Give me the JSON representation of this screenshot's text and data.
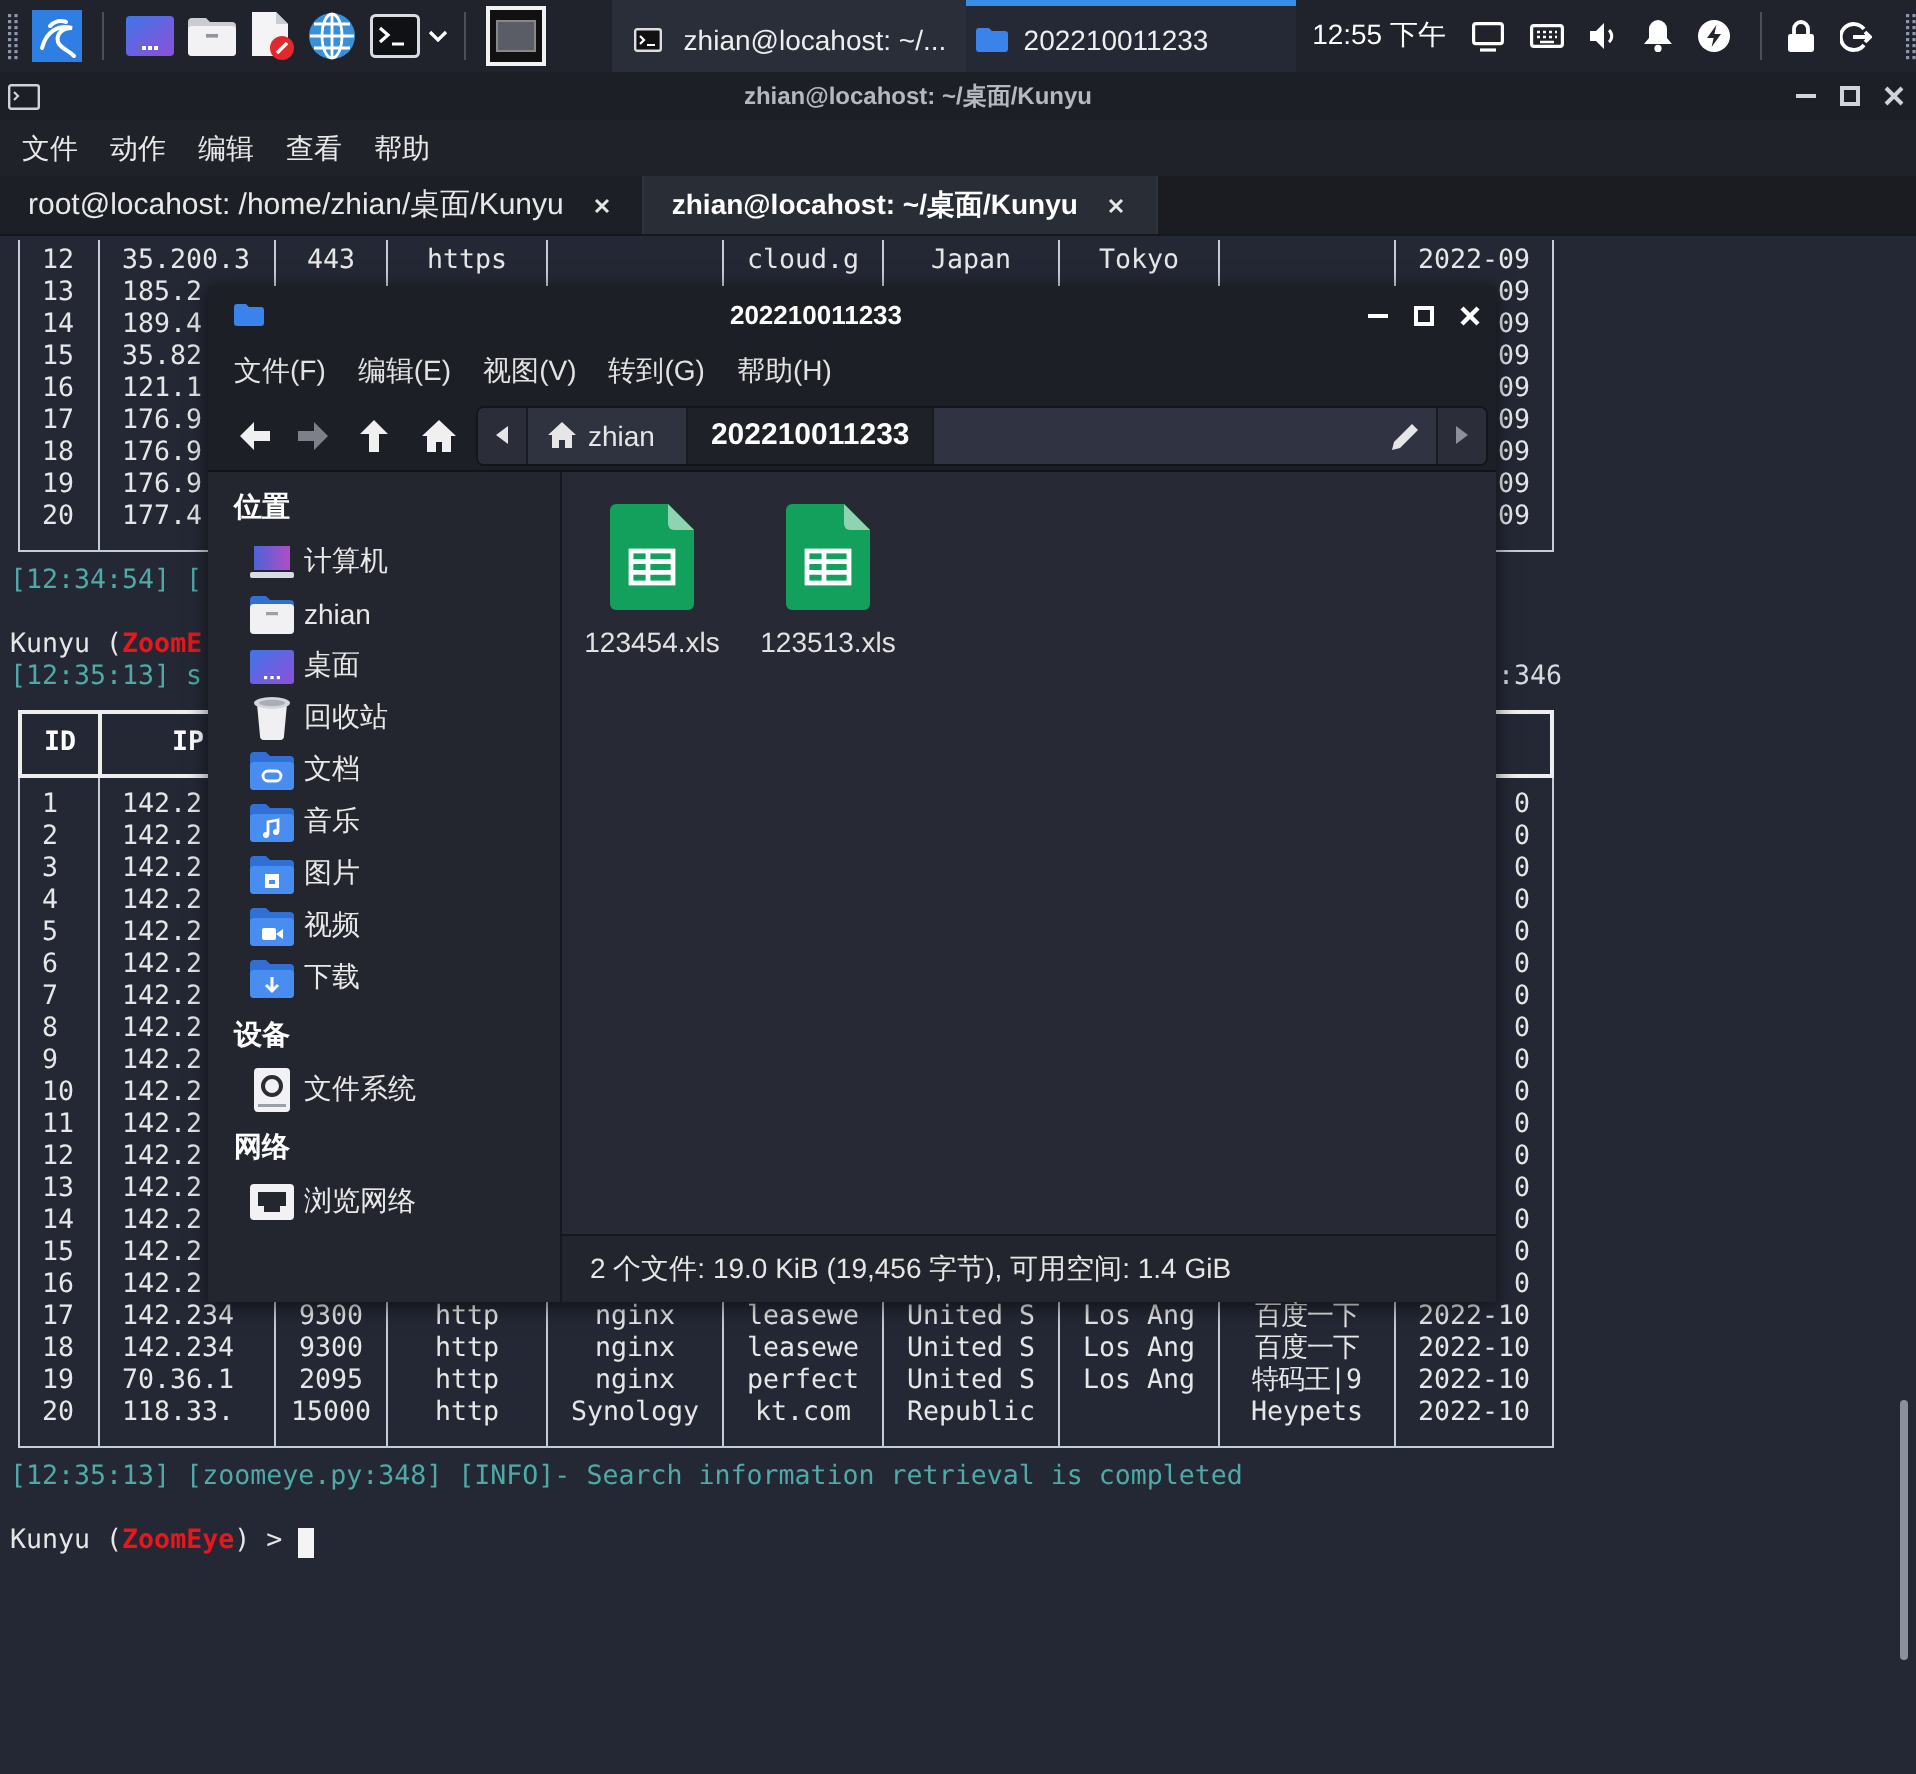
{
  "taskbar": {
    "tasks": [
      {
        "title": "zhian@locahost: ~/...",
        "kind": "terminal",
        "selected": false
      },
      {
        "title": "202210011233",
        "kind": "folder",
        "selected": true
      }
    ],
    "clock": "12:55 下午"
  },
  "terminal": {
    "title": "zhian@locahost: ~/桌面/Kunyu",
    "menu": [
      "文件",
      "动作",
      "编辑",
      "查看",
      "帮助"
    ],
    "tabs": [
      {
        "label": "root@locahost: /home/zhian/桌面/Kunyu",
        "selected": false
      },
      {
        "label": "zhian@locahost: ~/桌面/Kunyu",
        "selected": true
      }
    ],
    "output": [
      {
        "kind": "table",
        "rows": [
          {
            "column_1": "12",
            "column_2": "35.200.3",
            "column_3": "443",
            "column_4": "https",
            "column_6": "cloud.g",
            "column_7": "Japan",
            "column_8": "Tokyo",
            "column_10": "2022-09"
          },
          {
            "column_1": "13",
            "column_2": "185.2",
            "column_10": "09"
          },
          {
            "column_1": "14",
            "column_2": "189.4",
            "column_10": "09"
          },
          {
            "column_1": "15",
            "column_2": "35.82",
            "column_10": "09"
          },
          {
            "column_1": "16",
            "column_2": "121.1",
            "column_10": "09"
          },
          {
            "column_1": "17",
            "column_2": "176.9",
            "column_10": "09"
          },
          {
            "column_1": "18",
            "column_2": "176.9",
            "column_10": "09"
          },
          {
            "column_1": "19",
            "column_2": "176.9",
            "column_10": "09"
          },
          {
            "column_1": "20",
            "column_2": "177.4",
            "column_10": "09"
          }
        ]
      },
      {
        "kind": "log",
        "text": "[12:34:54] ["
      },
      {
        "kind": "prompt",
        "text": "Kunyu (",
        "highlight": "ZoomE"
      },
      {
        "kind": "log",
        "text": "[12:35:13] s",
        "tail": ":346"
      },
      {
        "kind": "table",
        "header": {
          "column_1": "ID",
          "column_2": "IP"
        },
        "rows": [
          {
            "column_1": "1",
            "column_2": "142.2",
            "column_10": "0"
          },
          {
            "column_1": "2",
            "column_2": "142.2",
            "column_10": "0"
          },
          {
            "column_1": "3",
            "column_2": "142.2",
            "column_10": "0"
          },
          {
            "column_1": "4",
            "column_2": "142.2",
            "column_10": "0"
          },
          {
            "column_1": "5",
            "column_2": "142.2",
            "column_10": "0"
          },
          {
            "column_1": "6",
            "column_2": "142.2",
            "column_10": "0"
          },
          {
            "column_1": "7",
            "column_2": "142.2",
            "column_10": "0"
          },
          {
            "column_1": "8",
            "column_2": "142.2",
            "column_10": "0"
          },
          {
            "column_1": "9",
            "column_2": "142.2",
            "column_10": "0"
          },
          {
            "column_1": "10",
            "column_2": "142.2",
            "column_10": "0"
          },
          {
            "column_1": "11",
            "column_2": "142.2",
            "column_10": "0"
          },
          {
            "column_1": "12",
            "column_2": "142.2",
            "column_10": "0"
          },
          {
            "column_1": "13",
            "column_2": "142.2",
            "column_10": "0"
          },
          {
            "column_1": "14",
            "column_2": "142.2",
            "column_10": "0"
          },
          {
            "column_1": "15",
            "column_2": "142.2",
            "column_10": "0"
          },
          {
            "column_1": "16",
            "column_2": "142.2",
            "column_10": "0"
          },
          {
            "column_1": "17",
            "column_2": "142.234",
            "column_3": "9300",
            "column_4": "http",
            "column_5": "nginx",
            "column_6": "leasewe",
            "column_7": "United S",
            "column_8": "Los Ang",
            "column_9": "百度一下",
            "column_10": "2022-10"
          },
          {
            "column_1": "18",
            "column_2": "142.234",
            "column_3": "9300",
            "column_4": "http",
            "column_5": "nginx",
            "column_6": "leasewe",
            "column_7": "United S",
            "column_8": "Los Ang",
            "column_9": "百度一下",
            "column_10": "2022-10"
          },
          {
            "column_1": "19",
            "column_2": "70.36.1",
            "column_3": "2095",
            "column_4": "http",
            "column_5": "nginx",
            "column_6": "perfect",
            "column_7": "United S",
            "column_8": "Los Ang",
            "column_9": "特码王|9",
            "column_10": "2022-10"
          },
          {
            "column_1": "20",
            "column_2": "118.33.",
            "column_3": "15000",
            "column_4": "http",
            "column_5": "Synology",
            "column_6": "kt.com",
            "column_7": "Republic",
            "column_9": "Heypets",
            "column_10": "2022-10"
          }
        ]
      },
      {
        "kind": "log",
        "text": "[12:35:13] [zoomeye.py:348] [INFO]- Search information retrieval is completed"
      },
      {
        "kind": "prompt",
        "text": "Kunyu (",
        "highlight": "ZoomEye",
        "suffix": ") > ",
        "cursor": true
      }
    ]
  },
  "file_manager": {
    "title": "202210011233",
    "menu": [
      "文件(F)",
      "编辑(E)",
      "视图(V)",
      "转到(G)",
      "帮助(H)"
    ],
    "nav": [
      {
        "kind": "back",
        "disabled": false
      },
      {
        "kind": "forward",
        "disabled": true
      },
      {
        "kind": "up",
        "disabled": false
      },
      {
        "kind": "home",
        "disabled": false
      }
    ],
    "path": [
      {
        "label": "zhian",
        "kind": "home",
        "selected": false
      },
      {
        "label": "202210011233",
        "kind": "folder",
        "selected": true
      }
    ],
    "sidebar": [
      {
        "heading": "位置",
        "items": [
          {
            "label": "计算机",
            "kind": "computer",
            "selected": false
          },
          {
            "label": "zhian",
            "kind": "home",
            "selected": false
          },
          {
            "label": "桌面",
            "kind": "desktop",
            "selected": false
          },
          {
            "label": "回收站",
            "kind": "trash",
            "selected": false
          },
          {
            "label": "文档",
            "kind": "documents",
            "selected": false
          },
          {
            "label": "音乐",
            "kind": "music",
            "selected": false
          },
          {
            "label": "图片",
            "kind": "pictures",
            "selected": false
          },
          {
            "label": "视频",
            "kind": "videos",
            "selected": false
          },
          {
            "label": "下载",
            "kind": "downloads",
            "selected": false
          }
        ]
      },
      {
        "heading": "设备",
        "items": [
          {
            "label": "文件系统",
            "kind": "drive",
            "selected": false
          }
        ]
      },
      {
        "heading": "网络",
        "items": [
          {
            "label": "浏览网络",
            "kind": "network",
            "selected": false
          }
        ]
      }
    ],
    "files": [
      {
        "name": "123454.xls",
        "selected": false
      },
      {
        "name": "123513.xls",
        "selected": false
      }
    ],
    "status": "2 个文件: 19.0 KiB (19,456 字节), 可用空间: 1.4 GiB"
  }
}
